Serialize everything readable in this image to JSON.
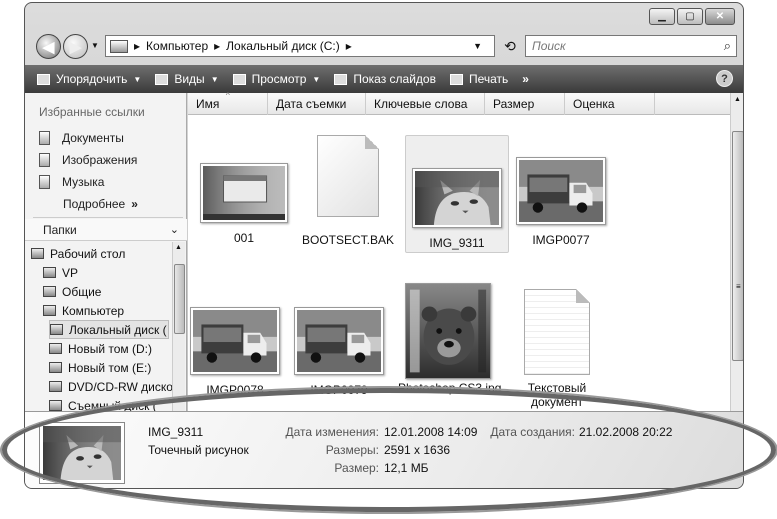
{
  "window": {
    "controls": [
      "minimize",
      "maximize",
      "close"
    ]
  },
  "nav": {
    "address": [
      "Компьютер",
      "Локальный диск (C:)"
    ],
    "search_placeholder": "Поиск"
  },
  "toolbar": {
    "organize": "Упорядочить",
    "views": "Виды",
    "preview": "Просмотр",
    "slideshow": "Показ слайдов",
    "print": "Печать",
    "more": "»",
    "help": "?"
  },
  "sidebar": {
    "favorites_header": "Избранные ссылки",
    "favorites": [
      {
        "label": "Документы",
        "icon": "documents-icon"
      },
      {
        "label": "Изображения",
        "icon": "pictures-icon"
      },
      {
        "label": "Музыка",
        "icon": "music-icon"
      }
    ],
    "more_label": "Подробнее",
    "more_arrows": "»",
    "folders_header": "Папки",
    "tree": [
      {
        "label": "Рабочий стол",
        "icon": "desktop-icon"
      },
      {
        "label": "VP",
        "icon": "user-folder-icon"
      },
      {
        "label": "Общие",
        "icon": "public-folder-icon"
      },
      {
        "label": "Компьютер",
        "icon": "computer-icon"
      },
      {
        "label": "Локальный диск (",
        "icon": "local-disk-icon",
        "selected": true
      },
      {
        "label": "Новый том (D:)",
        "icon": "drive-icon"
      },
      {
        "label": "Новый том (E:)",
        "icon": "drive-icon"
      },
      {
        "label": "DVD/CD-RW диско",
        "icon": "dvd-drive-icon"
      },
      {
        "label": "Съемный диск (",
        "icon": "removable-drive-icon"
      }
    ]
  },
  "columns": [
    "Имя",
    "Дата съемки",
    "Ключевые слова",
    "Размер",
    "Оценка"
  ],
  "items": [
    {
      "name": "001",
      "kind": "screenshot"
    },
    {
      "name": "BOOTSECT.BAK",
      "kind": "file"
    },
    {
      "name": "IMG_9311",
      "kind": "photo-cat",
      "selected": true
    },
    {
      "name": "IMGP0077",
      "kind": "photo-truck"
    },
    {
      "name": "IMGP0078",
      "kind": "photo-truck"
    },
    {
      "name": "IMGP0079",
      "kind": "photo-truck"
    },
    {
      "name": "Photoshop CS3.jpg",
      "kind": "photo-bear"
    },
    {
      "name": "Текстовый документ",
      "kind": "text"
    }
  ],
  "details": {
    "file_name": "IMG_9311",
    "file_type": "Точечный рисунок",
    "modified_label": "Дата изменения:",
    "modified_value": "12.01.2008 14:09",
    "dimensions_label": "Размеры:",
    "dimensions_value": "2591 x 1636",
    "size_label": "Размер:",
    "size_value": "12,1 МБ",
    "created_label": "Дата создания:",
    "created_value": "21.02.2008 20:22"
  }
}
